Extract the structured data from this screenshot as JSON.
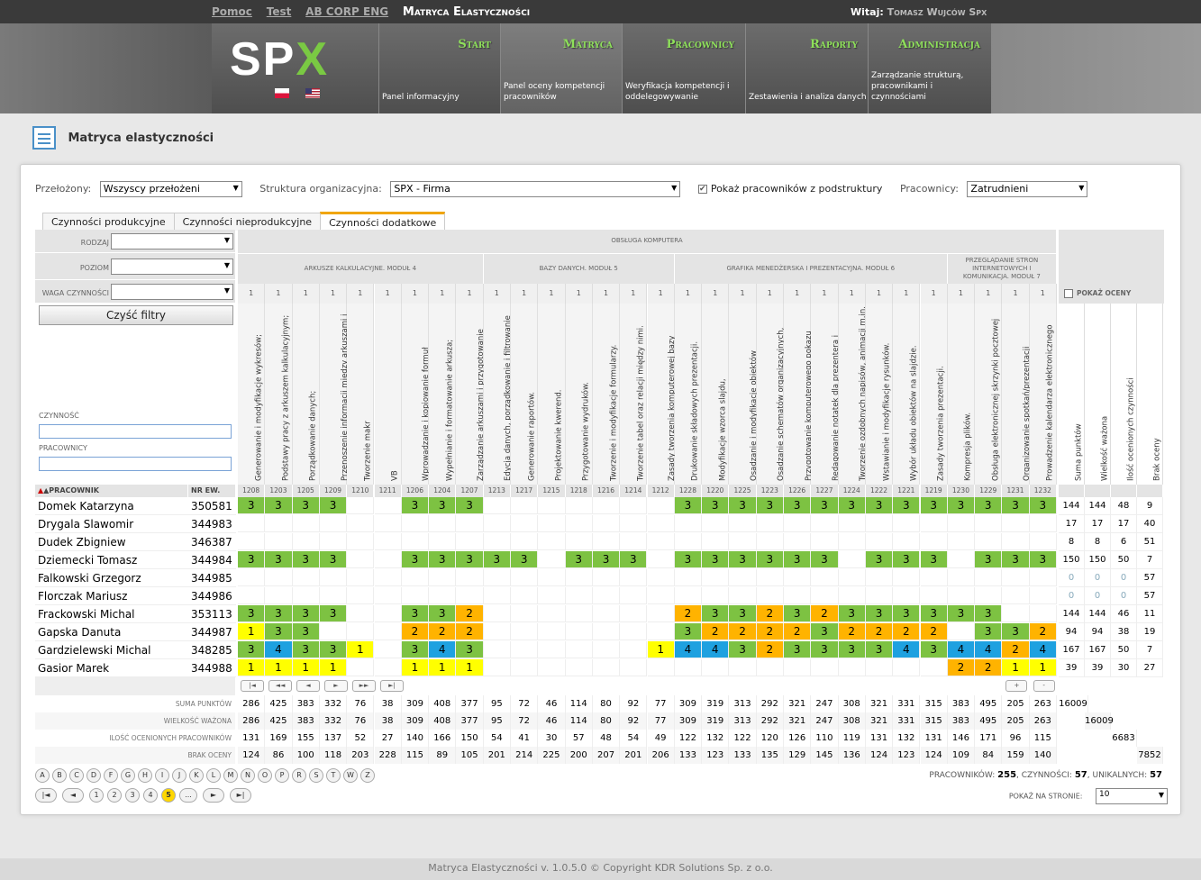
{
  "top": {
    "links": [
      "Pomoc",
      "Test",
      "AB CORP ENG"
    ],
    "current": "Matryca Elastyczności",
    "welcome_label": "Witaj:",
    "welcome_user": "Tomasz Wujców Spx"
  },
  "logo": {
    "text_a": "SP",
    "text_b": "X",
    "brand": "SPX"
  },
  "nav": [
    {
      "title": "Start",
      "desc": "Panel informacyjny"
    },
    {
      "title": "Matryca",
      "desc": "Panel oceny kompetencji pracowników"
    },
    {
      "title": "Pracownicy",
      "desc": "Weryfikacja kompetencji i oddelegowywanie"
    },
    {
      "title": "Raporty",
      "desc": "Zestawienia i analiza danych"
    },
    {
      "title": "Administracja",
      "desc": "Zarządzanie strukturą, pracownikami i czynnościami"
    }
  ],
  "page": {
    "title": "Matryca elastyczności"
  },
  "filters": {
    "superiors_label": "Przełożony:",
    "superiors_value": "Wszyscy przełożeni",
    "org_label": "Struktura organizacyjna:",
    "org_value": "SPX - Firma",
    "show_sub_label": "Pokaż pracowników z podstruktury",
    "employees_label": "Pracownicy:",
    "employees_value": "Zatrudnieni"
  },
  "tabs": [
    "Czynności produkcyjne",
    "Czynności nieprodukcyjne",
    "Czynności dodatkowe"
  ],
  "controls": {
    "rodzaj": "Rodzaj",
    "poziom": "Poziom",
    "waga": "Waga czynności",
    "clear": "Czyść filtry",
    "czynnosc": "Czynność",
    "pracownik": "Pracownicy",
    "col_worker": "▲Pracownik",
    "col_nr": "Nr ew.",
    "show_grades": "Pokaż oceny"
  },
  "group_top": "Obsługa komputera",
  "groups": [
    {
      "name": "Arkusze kalkulacyjne. Moduł 4",
      "span": 9
    },
    {
      "name": "Bazy danych. Moduł 5",
      "span": 7
    },
    {
      "name": "Grafika menedżerska i prezentacyjna. Moduł 6",
      "span": 10
    },
    {
      "name": "Przeglądanie stron internetowych i komunikacja. Moduł 7",
      "span": 4
    }
  ],
  "columns": [
    {
      "name": "Generowanie i modyfikacje wykresów;",
      "code": "1208"
    },
    {
      "name": "Podstawy pracy z arkuszem kalkulacyjnym;",
      "code": "1203"
    },
    {
      "name": "Porządkowanie danych;",
      "code": "1205"
    },
    {
      "name": "Przenoszenie informacji między arkuszami i skoroszytami.",
      "code": "1209"
    },
    {
      "name": "Tworzenie makr",
      "code": "1210"
    },
    {
      "name": "VB",
      "code": "1211"
    },
    {
      "name": "Wprowadzanie i kopiowanie formuł matematycznych oraz funkcji;",
      "code": "1206"
    },
    {
      "name": "Wypełnianie i formatowanie arkusza;",
      "code": "1204"
    },
    {
      "name": "Zarządzanie arkuszami i przygotowanie wydruku arkusza;",
      "code": "1207"
    },
    {
      "name": "Edycja danych, porządkowanie i filtrowanie danych.",
      "code": "1213"
    },
    {
      "name": "Generowanie raportów.",
      "code": "1217"
    },
    {
      "name": "Projektowanie kwerend.",
      "code": "1215"
    },
    {
      "name": "Przygotowanie wydruków.",
      "code": "1218"
    },
    {
      "name": "Tworzenie i modyfikacje formularzy.",
      "code": "1216"
    },
    {
      "name": "Tworzenie tabel oraz relacji między nimi.",
      "code": "1214"
    },
    {
      "name": "Zasady tworzenia komputerowej bazy danych.",
      "code": "1212"
    },
    {
      "name": "Drukowanie składowych prezentacji.",
      "code": "1228"
    },
    {
      "name": "Modyfikacje wzorca slajdu,",
      "code": "1220"
    },
    {
      "name": "Osadzanie i modyfikacje obiektów rysunkowych.",
      "code": "1225"
    },
    {
      "name": "Osadzanie schematów organizacyjnych, wykresów i tabel.",
      "code": "1223"
    },
    {
      "name": "Przygotowanie komputerowego pokazu slajdów.",
      "code": "1226"
    },
    {
      "name": "Redagowanie notatek dla prezentera i materiałów informacyjnych dla",
      "code": "1227"
    },
    {
      "name": "Tworzenie ozdobnych napisów, animacji m.in. WordArt.",
      "code": "1224"
    },
    {
      "name": "Wstawianie i modyfikacje rysunków.",
      "code": "1222"
    },
    {
      "name": "Wybór układu obiektów na slajdzie.",
      "code": "1221"
    },
    {
      "name": "Zasady tworzenia prezentacji.",
      "code": "1219"
    },
    {
      "name": "Kompresja plików.",
      "code": "1230"
    },
    {
      "name": "Obsługa elektronicznej skrzynki pocztowej",
      "code": "1229"
    },
    {
      "name": "Organizowanie spotkań/prezentacji sieciowych",
      "code": "1231"
    },
    {
      "name": "Prowadzenie kalendarza elektronicznego",
      "code": "1232"
    }
  ],
  "weight": "1",
  "sum_columns": [
    "Suma punktów",
    "Wielkość ważona",
    "Ilość ocenionych czynności",
    "Brak oceny"
  ],
  "rows": [
    {
      "name": "Domek Katarzyna",
      "nr": "350581",
      "g": [
        3,
        3,
        3,
        3,
        0,
        0,
        3,
        3,
        3,
        0,
        0,
        0,
        0,
        0,
        0,
        0,
        3,
        3,
        3,
        3,
        3,
        3,
        3,
        3,
        3,
        3,
        3,
        3,
        3,
        3
      ],
      "s": [
        "144",
        "144",
        "48",
        "9"
      ]
    },
    {
      "name": "Drygala Slawomir",
      "nr": "344983",
      "g": [
        0,
        0,
        0,
        0,
        0,
        0,
        0,
        0,
        0,
        0,
        0,
        0,
        0,
        0,
        0,
        0,
        0,
        0,
        0,
        0,
        0,
        0,
        0,
        0,
        0,
        0,
        0,
        0,
        0,
        0
      ],
      "s": [
        "17",
        "17",
        "17",
        "40"
      ]
    },
    {
      "name": "Dudek Zbigniew",
      "nr": "346387",
      "g": [
        0,
        0,
        0,
        0,
        0,
        0,
        0,
        0,
        0,
        0,
        0,
        0,
        0,
        0,
        0,
        0,
        0,
        0,
        0,
        0,
        0,
        0,
        0,
        0,
        0,
        0,
        0,
        0,
        0,
        0
      ],
      "s": [
        "8",
        "8",
        "6",
        "51"
      ]
    },
    {
      "name": "Dziemecki Tomasz",
      "nr": "344984",
      "g": [
        3,
        3,
        3,
        3,
        0,
        0,
        3,
        3,
        3,
        3,
        3,
        0,
        3,
        3,
        3,
        0,
        3,
        3,
        3,
        3,
        3,
        3,
        0,
        3,
        3,
        3,
        0,
        3,
        3,
        3
      ],
      "s": [
        "150",
        "150",
        "50",
        "7"
      ]
    },
    {
      "name": "Falkowski Grzegorz",
      "nr": "344985",
      "g": [
        0,
        0,
        0,
        0,
        0,
        0,
        0,
        0,
        0,
        0,
        0,
        0,
        0,
        0,
        0,
        0,
        0,
        0,
        0,
        0,
        0,
        0,
        0,
        0,
        0,
        0,
        0,
        0,
        0,
        0
      ],
      "s": [
        "0",
        "0",
        "0",
        "57"
      ]
    },
    {
      "name": "Florczak Mariusz",
      "nr": "344986",
      "g": [
        0,
        0,
        0,
        0,
        0,
        0,
        0,
        0,
        0,
        0,
        0,
        0,
        0,
        0,
        0,
        0,
        0,
        0,
        0,
        0,
        0,
        0,
        0,
        0,
        0,
        0,
        0,
        0,
        0,
        0
      ],
      "s": [
        "0",
        "0",
        "0",
        "57"
      ]
    },
    {
      "name": "Frackowski Michal",
      "nr": "353113",
      "g": [
        3,
        3,
        3,
        3,
        0,
        0,
        3,
        3,
        2,
        0,
        0,
        0,
        0,
        0,
        0,
        0,
        2,
        3,
        3,
        2,
        3,
        2,
        3,
        3,
        3,
        3,
        3,
        3,
        0,
        0
      ],
      "s": [
        "144",
        "144",
        "46",
        "11"
      ]
    },
    {
      "name": "Gapska Danuta",
      "nr": "344987",
      "g": [
        1,
        3,
        3,
        0,
        0,
        0,
        2,
        2,
        2,
        0,
        0,
        0,
        0,
        0,
        0,
        0,
        3,
        2,
        2,
        2,
        2,
        3,
        2,
        2,
        2,
        2,
        0,
        3,
        3,
        2
      ],
      "s": [
        "94",
        "94",
        "38",
        "19"
      ]
    },
    {
      "name": "Gardzielewski Michal",
      "nr": "348285",
      "g": [
        3,
        4,
        3,
        3,
        1,
        0,
        3,
        4,
        3,
        0,
        0,
        0,
        0,
        0,
        0,
        1,
        4,
        4,
        3,
        2,
        3,
        3,
        3,
        3,
        4,
        3,
        4,
        4,
        2,
        4
      ],
      "s": [
        "167",
        "167",
        "50",
        "7"
      ]
    },
    {
      "name": "Gasior Marek",
      "nr": "344988",
      "g": [
        1,
        1,
        1,
        1,
        0,
        0,
        1,
        1,
        1,
        0,
        0,
        0,
        0,
        0,
        0,
        0,
        0,
        0,
        0,
        0,
        0,
        0,
        0,
        0,
        0,
        0,
        2,
        2,
        1,
        1
      ],
      "s": [
        "39",
        "39",
        "30",
        "27"
      ]
    }
  ],
  "footer_rows": [
    {
      "label": "Suma punktów",
      "v": [
        "286",
        "425",
        "383",
        "332",
        "76",
        "38",
        "309",
        "408",
        "377",
        "95",
        "72",
        "46",
        "114",
        "80",
        "92",
        "77",
        "309",
        "319",
        "313",
        "292",
        "321",
        "247",
        "308",
        "321",
        "331",
        "315",
        "383",
        "495",
        "205",
        "263"
      ],
      "total": "16009"
    },
    {
      "label": "Wielkość ważona",
      "v": [
        "286",
        "425",
        "383",
        "332",
        "76",
        "38",
        "309",
        "408",
        "377",
        "95",
        "72",
        "46",
        "114",
        "80",
        "92",
        "77",
        "309",
        "319",
        "313",
        "292",
        "321",
        "247",
        "308",
        "321",
        "331",
        "315",
        "383",
        "495",
        "205",
        "263"
      ],
      "total": "16009"
    },
    {
      "label": "Ilość ocenionych pracowników",
      "v": [
        "131",
        "169",
        "155",
        "137",
        "52",
        "27",
        "140",
        "166",
        "150",
        "54",
        "41",
        "30",
        "57",
        "48",
        "54",
        "49",
        "122",
        "132",
        "122",
        "120",
        "126",
        "110",
        "119",
        "131",
        "132",
        "131",
        "146",
        "171",
        "96",
        "115"
      ],
      "total": "6683"
    },
    {
      "label": "Brak oceny",
      "v": [
        "124",
        "86",
        "100",
        "118",
        "203",
        "228",
        "115",
        "89",
        "105",
        "201",
        "214",
        "225",
        "200",
        "207",
        "201",
        "206",
        "133",
        "123",
        "133",
        "135",
        "129",
        "145",
        "136",
        "124",
        "123",
        "124",
        "109",
        "84",
        "159",
        "140"
      ],
      "total": "7852"
    }
  ],
  "letters": [
    "A",
    "B",
    "C",
    "D",
    "F",
    "G",
    "H",
    "I",
    "J",
    "K",
    "L",
    "M",
    "N",
    "O",
    "P",
    "R",
    "S",
    "T",
    "W",
    "Z"
  ],
  "pages": [
    "1",
    "2",
    "3",
    "4",
    "5",
    "..."
  ],
  "current_page": "5",
  "stats": {
    "emp_label": "Pracowników:",
    "emp": "255",
    "act_label": "czynności:",
    "act": "57",
    "uniq_label": "unikalnych:",
    "uniq": "57"
  },
  "perpage": {
    "label": "Pokaż na stronie:",
    "value": "10"
  },
  "colors": {
    "g1": "#ffff00",
    "g2": "#ffb300",
    "g3": "#7dc242",
    "g4": "#1ea1e0",
    "accent": "#f0a500"
  },
  "footer": "Matryca Elastyczności v. 1.0.5.0    © Copyright KDR Solutions Sp. z o.o."
}
